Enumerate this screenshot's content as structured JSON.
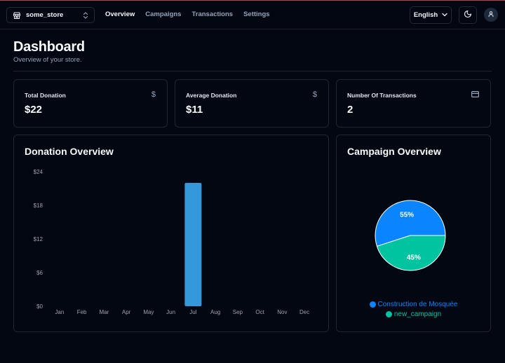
{
  "navbar": {
    "store_name": "some_store",
    "store_icon": "store-icon",
    "switcher_icon": "chevrons-up-down-icon",
    "links": [
      {
        "label": "Overview",
        "active": true
      },
      {
        "label": "Campaigns",
        "active": false
      },
      {
        "label": "Transactions",
        "active": false
      },
      {
        "label": "Settings",
        "active": false
      }
    ],
    "language": "English",
    "language_icon": "chevron-down-icon",
    "theme_icon": "moon-icon",
    "user_icon": "user-icon"
  },
  "header": {
    "title": "Dashboard",
    "subtitle": "Overview of your store."
  },
  "stats": [
    {
      "label": "Total Donation",
      "value": "$22",
      "icon": "dollar-icon"
    },
    {
      "label": "Average Donation",
      "value": "$11",
      "icon": "dollar-icon"
    },
    {
      "label": "Number Of Transactions",
      "value": "2",
      "icon": "credit-card-icon"
    }
  ],
  "colors": {
    "bar": "#3498db",
    "pie_a": "#0a84ff",
    "pie_b": "#00c49f",
    "background": "#030712"
  },
  "chart_data": [
    {
      "type": "bar",
      "title": "Donation Overview",
      "categories": [
        "Jan",
        "Feb",
        "Mar",
        "Apr",
        "May",
        "Jun",
        "Jul",
        "Aug",
        "Sep",
        "Oct",
        "Nov",
        "Dec"
      ],
      "values": [
        0,
        0,
        0,
        0,
        0,
        0,
        22,
        0,
        0,
        0,
        0,
        0
      ],
      "yticks": [
        "$0",
        "$6",
        "$12",
        "$18",
        "$24"
      ],
      "ytick_values": [
        0,
        6,
        12,
        18,
        24
      ],
      "ylim": [
        0,
        24
      ],
      "xlabel": "",
      "ylabel": "",
      "grid": false
    },
    {
      "type": "pie",
      "title": "Campaign Overview",
      "slices": [
        {
          "label": "Construction de Mosquée",
          "value": 55,
          "display": "55%"
        },
        {
          "label": "new_campaign",
          "value": 45,
          "display": "45%"
        }
      ],
      "legend": "bottom"
    }
  ]
}
